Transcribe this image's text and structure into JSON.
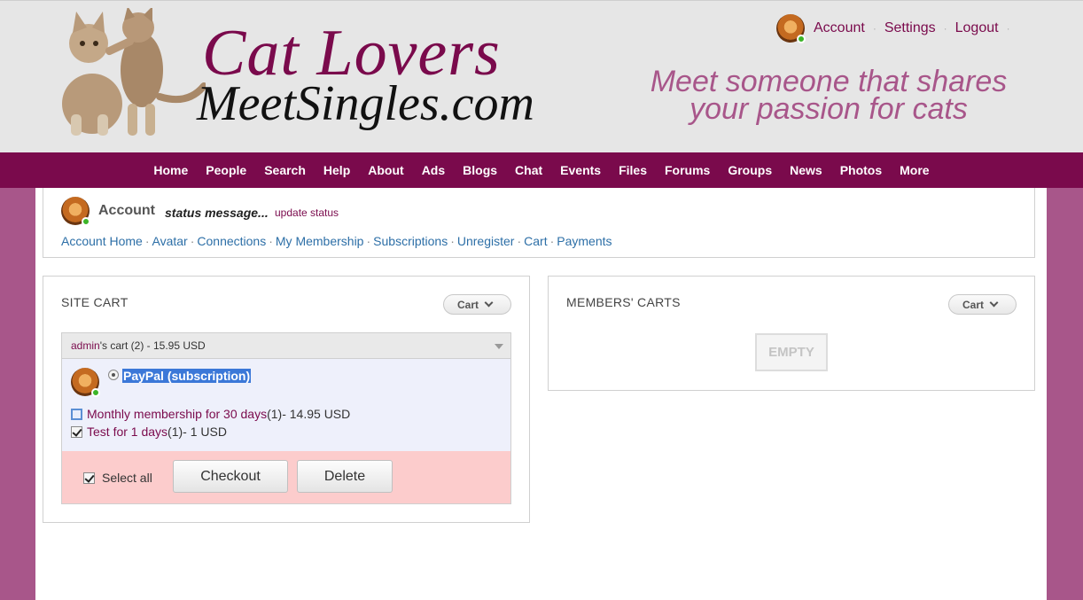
{
  "header": {
    "logo_line1": "Cat Lovers",
    "logo_line2": "MeetSingles.com",
    "tagline_line1": "Meet someone that shares",
    "tagline_line2": "your passion for cats",
    "top_links": [
      "Account",
      "Settings",
      "Logout"
    ]
  },
  "nav": [
    "Home",
    "People",
    "Search",
    "Help",
    "About",
    "Ads",
    "Blogs",
    "Chat",
    "Events",
    "Files",
    "Forums",
    "Groups",
    "News",
    "Photos",
    "More"
  ],
  "account": {
    "name": "Account",
    "status": "status message...",
    "update": "update status",
    "links": [
      "Account Home",
      "Avatar",
      "Connections",
      "My Membership",
      "Subscriptions",
      "Unregister",
      "Cart",
      "Payments"
    ]
  },
  "site_cart": {
    "title": "SITE CART",
    "menu_label": "Cart",
    "select_owner": "admin",
    "select_rest": "'s cart (2) - 15.95 USD",
    "payment_method": "PayPal (subscription)",
    "items": [
      {
        "name": "Monthly membership for 30 days",
        "qty": " (1)",
        "amount": " - 14.95 USD",
        "checked": false
      },
      {
        "name": "Test for 1 days",
        "qty": " (1)",
        "amount": " - 1 USD",
        "checked": true
      }
    ],
    "select_all": "Select all",
    "checkout": "Checkout",
    "delete": "Delete"
  },
  "members_carts": {
    "title": "MEMBERS' CARTS",
    "menu_label": "Cart",
    "empty": "EMPTY"
  },
  "colors": {
    "brand": "#7a0a4c",
    "accent": "#a8568a",
    "link": "#2d6fa7",
    "footer_pink": "#fccccc",
    "online": "#3cb528"
  }
}
